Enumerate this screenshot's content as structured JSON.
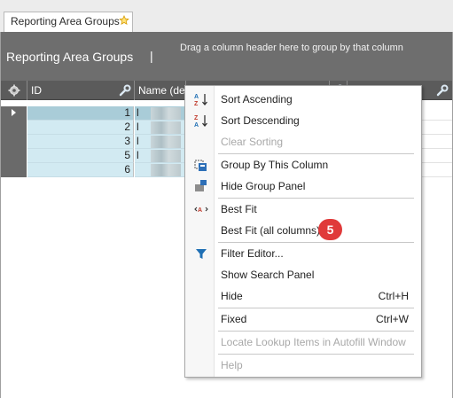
{
  "tab": {
    "title": "Reporting Area Groups"
  },
  "group_panel": {
    "title": "Reporting Area Groups",
    "separator": "|",
    "hint": "Drag a column header here to group by that column"
  },
  "grid": {
    "columns": [
      {
        "label": "ID"
      },
      {
        "label": "Name (de"
      }
    ],
    "rows": [
      {
        "id": "1",
        "name": "l"
      },
      {
        "id": "2",
        "name": "l"
      },
      {
        "id": "3",
        "name": "l"
      },
      {
        "id": "5",
        "name": "l"
      },
      {
        "id": "6",
        "name": ""
      }
    ]
  },
  "context_menu": {
    "sort_ascending": "Sort Ascending",
    "sort_descending": "Sort Descending",
    "clear_sorting": "Clear Sorting",
    "group_by_column": "Group By This Column",
    "hide_group_panel": "Hide Group Panel",
    "best_fit": "Best Fit",
    "best_fit_all": "Best Fit (all columns)",
    "filter_editor": "Filter Editor...",
    "show_search_panel": "Show Search Panel",
    "hide": "Hide",
    "hide_shortcut": "Ctrl+H",
    "fixed": "Fixed",
    "fixed_shortcut": "Ctrl+W",
    "locate_lookup": "Locate Lookup Items in Autofill Window",
    "help": "Help"
  },
  "annotation": {
    "step_number": "5"
  },
  "colors": {
    "group_panel": "#6e6e6e",
    "header": "#5b5b5b",
    "row_bg": "#d2eaf2",
    "row_selected": "#a9ccd8",
    "badge": "#e03a3a",
    "filter_icon": "#1f6fb4"
  },
  "icons": {
    "tab_pin": "pin-icon",
    "column_chooser": "gear-icon",
    "column_options": "wrench-icon",
    "sort_asc": "sort-ascending-icon",
    "sort_desc": "sort-descending-icon",
    "group_by": "group-by-icon",
    "hide_group_panel": "hide-group-panel-icon",
    "best_fit": "best-fit-icon",
    "filter": "filter-icon"
  }
}
